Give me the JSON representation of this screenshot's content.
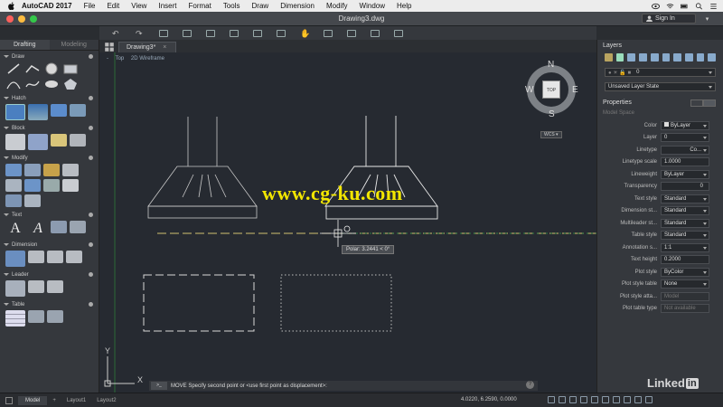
{
  "menubar": {
    "app_name": "AutoCAD 2017",
    "items": [
      "File",
      "Edit",
      "View",
      "Insert",
      "Format",
      "Tools",
      "Draw",
      "Dimension",
      "Modify",
      "Window",
      "Help"
    ]
  },
  "window": {
    "title": "Drawing3.dwg",
    "sign_in": "Sign In"
  },
  "left_panel": {
    "tabs": [
      "Drafting",
      "Modeling"
    ],
    "sections": [
      "Draw",
      "Hatch",
      "Block",
      "Modify",
      "Text",
      "Dimension",
      "Leader",
      "Table"
    ]
  },
  "drawing_tab": "Drawing3*",
  "viewport": {
    "view": "Top",
    "style": "2D Wireframe"
  },
  "viewcube": {
    "n": "N",
    "s": "S",
    "e": "E",
    "w": "W",
    "top": "TOP",
    "wcs": "WCS"
  },
  "watermark": "www.cg-ku.com",
  "tooltip": "Polar: 3.2441 < 0°",
  "command_line": {
    "prompt": ">_",
    "text": "MOVE Specify second point or <use first point as displacement>:",
    "help": "?"
  },
  "layers": {
    "title": "Layers",
    "current": "0",
    "state": "Unsaved Layer State"
  },
  "properties": {
    "title": "Properties",
    "space": "Model Space",
    "rows": [
      {
        "label": "Color",
        "value": "ByLayer"
      },
      {
        "label": "Layer",
        "value": "0"
      },
      {
        "label": "Linetype",
        "value": "Co..."
      },
      {
        "label": "Linetype scale",
        "value": "1.0000"
      },
      {
        "label": "Lineweight",
        "value": "ByLayer"
      },
      {
        "label": "Transparency",
        "value": "0"
      },
      {
        "label": "Text style",
        "value": "Standard"
      },
      {
        "label": "Dimension st...",
        "value": "Standard"
      },
      {
        "label": "Multileader st...",
        "value": "Standard"
      },
      {
        "label": "Table style",
        "value": "Standard"
      },
      {
        "label": "Annotation s...",
        "value": "1:1"
      },
      {
        "label": "Text height",
        "value": "0.2000"
      },
      {
        "label": "Plot style",
        "value": "ByColor"
      },
      {
        "label": "Plot style table",
        "value": "None"
      },
      {
        "label": "Plot style atta...",
        "value": "Model"
      },
      {
        "label": "Plot table type",
        "value": "Not available"
      }
    ]
  },
  "statusbar": {
    "tabs": [
      "Model",
      "Layout1",
      "Layout2"
    ],
    "coords": "4.0220, 6.2590, 0.0000"
  },
  "brand": {
    "text": "Linked",
    "in": "in"
  },
  "colors": {
    "canvas": "#262a31",
    "accent_yellow": "#f2e600",
    "panel": "#35383d"
  }
}
